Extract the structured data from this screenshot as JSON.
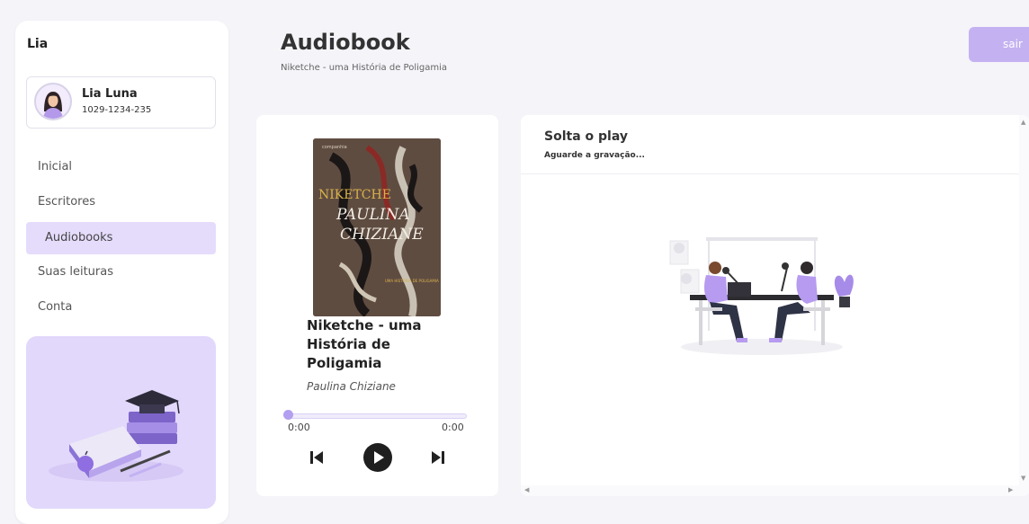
{
  "sidebar": {
    "app_title": "Lia",
    "user": {
      "name": "Lia Luna",
      "id": "1029-1234-235"
    },
    "nav": [
      {
        "label": "Inicial",
        "active": false
      },
      {
        "label": "Escritores",
        "active": false
      },
      {
        "label": "Audiobooks",
        "active": true
      },
      {
        "label": "Suas leituras",
        "active": false
      },
      {
        "label": "Conta",
        "active": false
      }
    ]
  },
  "header": {
    "title": "Audiobook",
    "subtitle": "Niketche - uma História de Poligamia",
    "logout_label": "sair"
  },
  "player": {
    "cover_texts": {
      "publisher": "companhia",
      "author_line1": "PAULINA",
      "author_line2": "CHIZIANE",
      "title": "NIKETCHE",
      "series": "UMA HISTÓRIA DE POLIGAMIA"
    },
    "book_title": "Niketche - uma História de Poligamia",
    "author": "Paulina Chiziane",
    "current_time": "0:00",
    "duration": "0:00",
    "progress": 0,
    "controls": {
      "prev_icon": "skip-previous-icon",
      "play_icon": "play-icon",
      "next_icon": "skip-next-icon"
    }
  },
  "recording": {
    "title": "Solta o play",
    "status": "Aguarde a gravação..."
  },
  "colors": {
    "accent": "#c4b1f2",
    "active_nav": "#e5dcfc",
    "promo_bg": "#e2d8fb",
    "background": "#f4f4f9"
  }
}
